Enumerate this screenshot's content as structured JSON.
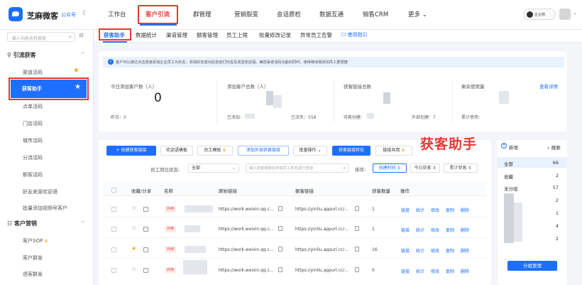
{
  "brand": {
    "name": "芝麻微客",
    "tag": "公众号"
  },
  "topnav": {
    "items": [
      "工作台",
      "客户引流",
      "群管理",
      "营销裂变",
      "会话质检",
      "数据互通",
      "销售CRM",
      "更多"
    ],
    "active": "客户引流",
    "user_label": "企业微"
  },
  "sidebar": {
    "search_placeholder": "输入功能名称搜索",
    "group1": "引流获客",
    "items1": [
      "渠道活码",
      "获客助手",
      "点单活码",
      "门店活码",
      "城市活码",
      "分流活码",
      "额客活码",
      "好友来源欢迎语",
      "批量添加视频号客户"
    ],
    "active_item": "获客助手",
    "group2": "客户营销",
    "items2": [
      "客户SOP",
      "客户群发",
      "退客群发"
    ]
  },
  "subtabs": [
    "获客助手",
    "数据统计",
    "渠道管理",
    "额客管理",
    "员工上限",
    "批量修改记录",
    "异常员工告警"
  ],
  "help_link": "使用指引",
  "notice": "客户可以通过点击连接添加企业员工为好友，添加好友成功后自动打标签及发送欢迎语。兼容渠道活码功能的同时，使得移动端添加员工更便捷",
  "stats": {
    "today_label": "今日添加客户数（人）",
    "today_value": "0",
    "yesterday_label": "昨日：0",
    "total_label": "添加客户总数（人）",
    "added_label": "已添加:",
    "lost_label": "已流失：558",
    "links_label": "获客链接总数",
    "ready_label": "待客创建:",
    "external_label": "外部创建：7",
    "remain_label": "剩余使用量",
    "detail_link": "查看详情",
    "cumulative_label": "累计使用:"
  },
  "toolbar": {
    "create": "+ 创建获客链接",
    "welcome": "欢迎语模板",
    "staff_tpl": "员工模板",
    "add_external": "添加外部获客链接",
    "batch": "批量操作",
    "convert": "获客链接转化",
    "link_share": "链接共用"
  },
  "filters": {
    "status_label": "员工岗位状态:",
    "status_value": "全部",
    "search_placeholder": "输入获客链接名称或员工姓名进行查询",
    "sort_label": "排序:",
    "sort_items": [
      "创建时间",
      "今日获客",
      "累计获客"
    ]
  },
  "table": {
    "headers": [
      "收藏/分享",
      "名称",
      "原始链接",
      "额客链接",
      "获客数量",
      "操作"
    ],
    "rows": [
      {
        "starred": false,
        "tag": "外用",
        "raw": "https://work.weixin.qq.c...",
        "link": "https://yinliu.appurl.cc/...",
        "count": "1"
      },
      {
        "starred": false,
        "tag": "外用",
        "raw": "https://work.weixin.qq.c...",
        "link": "https://yinliu.appurl.cc/...",
        "count": "1"
      },
      {
        "starred": true,
        "tag": "外用",
        "raw": "https://work.weixin.qq.c...",
        "link": "https://yinliu.appurl.cc/...",
        "count": "16"
      },
      {
        "starred": false,
        "tag": "外用",
        "raw": "https://work.weixin.qq.c...",
        "link": "https://yinliu.appurl.cc/...",
        "count": "0"
      }
    ],
    "ops": [
      "链接",
      "统计",
      "修改",
      "复制",
      "删除"
    ]
  },
  "annotation": "获客助手",
  "right_panel": {
    "new": "新增",
    "search": "搜索",
    "groups": [
      {
        "name": "全部",
        "count": "66"
      },
      {
        "name": "收藏",
        "count": "2"
      },
      {
        "name": "未分组",
        "count": "57"
      }
    ],
    "counts": [
      "2",
      "1",
      "4",
      "2"
    ],
    "manage": "分组管理"
  },
  "colors": {
    "accent": "#1e6fff",
    "highlight": "#e53935",
    "star": "#f5a623"
  }
}
